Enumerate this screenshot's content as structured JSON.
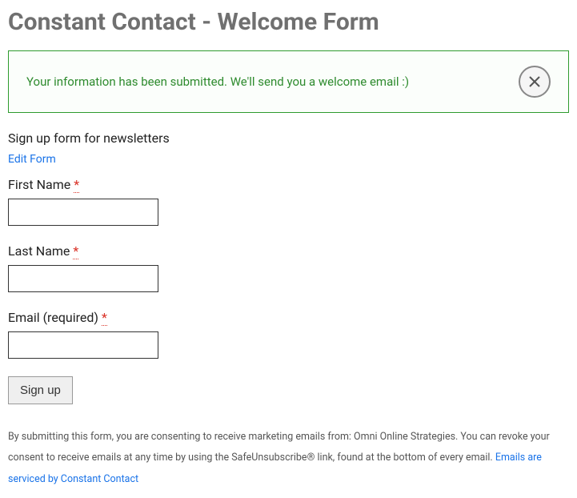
{
  "page": {
    "title": "Constant Contact - Welcome Form"
  },
  "alert": {
    "message": "Your information has been submitted. We'll send you a welcome email :)"
  },
  "form": {
    "intro": "Sign up form for newsletters",
    "edit_link": "Edit Form",
    "fields": {
      "first_name": {
        "label": "First Name",
        "required_mark": "*",
        "value": ""
      },
      "last_name": {
        "label": "Last Name",
        "required_mark": "*",
        "value": ""
      },
      "email": {
        "label": "Email (required)",
        "required_mark": "*",
        "value": ""
      }
    },
    "submit_label": "Sign up"
  },
  "disclaimer": {
    "text_part1": "By submitting this form, you are consenting to receive marketing emails from: Omni Online Strategies. You can revoke your consent to receive emails at any time by using the SafeUnsubscribe® link, found at the bottom of every email. ",
    "link_text": "Emails are serviced by Constant Contact"
  }
}
